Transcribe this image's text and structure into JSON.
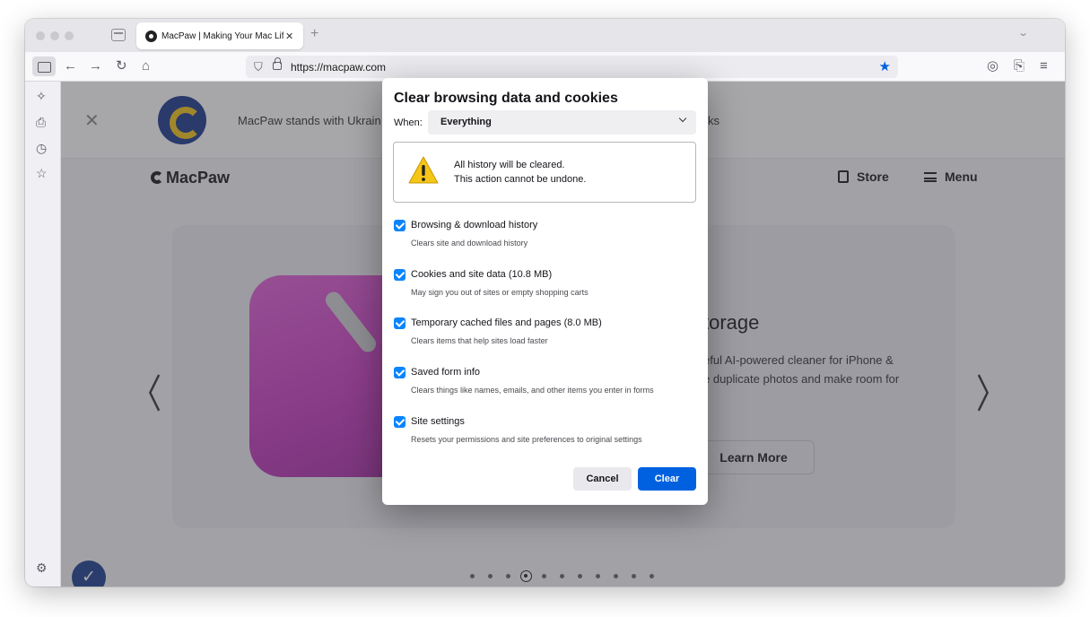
{
  "browser": {
    "tab": {
      "title": "MacPaw | Making Your Mac Life",
      "close": "✕"
    },
    "new_tab": "+",
    "tab_overflow": "⌄",
    "url": "https://macpaw.com",
    "nav_icons": {
      "back": "←",
      "forward": "→",
      "reload": "↻",
      "home": "⌂"
    },
    "right_icons": {
      "account": "◎",
      "extensions": "⎘",
      "menu": "≡"
    },
    "sidebar_icons": {
      "ai": "✧",
      "sync": "⎙",
      "history": "◷",
      "bookmarks": "☆",
      "settings": "⚙"
    }
  },
  "page": {
    "banner": {
      "close": "✕",
      "text_left": "MacPaw stands with Ukrain",
      "text_right": "ks"
    },
    "brand": "MacPaw",
    "nav": {
      "store": "Store",
      "menu": "Menu"
    },
    "hero": {
      "title": "torage",
      "desc_line1": "eful AI-powered cleaner for iPhone &",
      "desc_line2": "e duplicate photos and make room for",
      "cta": "Learn More"
    },
    "carousel": {
      "prev": "〈",
      "next": "〉",
      "total": 11,
      "active": 3
    },
    "badge_icon": "✓"
  },
  "dialog": {
    "title": "Clear browsing data and cookies",
    "when_label": "When:",
    "when_value": "Everything",
    "warning": {
      "line1": "All history will be cleared.",
      "line2": "This action cannot be undone."
    },
    "options": [
      {
        "label": "Browsing & download history",
        "desc": "Clears site and download history",
        "checked": true
      },
      {
        "label": "Cookies and site data (10.8 MB)",
        "desc": "May sign you out of sites or empty shopping carts",
        "checked": true
      },
      {
        "label": "Temporary cached files and pages (8.0 MB)",
        "desc": "Clears items that help sites load faster",
        "checked": true
      },
      {
        "label": "Saved form info",
        "desc": "Clears things like names, emails, and other items you enter in forms",
        "checked": true
      },
      {
        "label": "Site settings",
        "desc": "Resets your permissions and site preferences to original settings",
        "checked": true
      }
    ],
    "buttons": {
      "cancel": "Cancel",
      "clear": "Clear"
    }
  },
  "colors": {
    "accent": "#0061e0",
    "checkbox": "#0a84ff",
    "warning_yellow": "#f5c518"
  }
}
